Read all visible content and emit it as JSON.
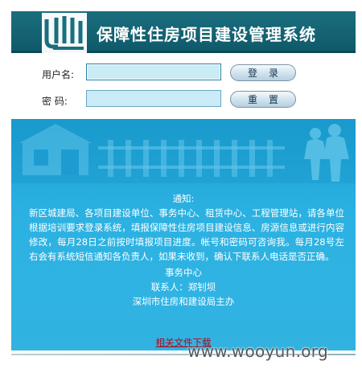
{
  "header": {
    "title": "保障性住房项目建设管理系统",
    "logo": "jh-building-logo"
  },
  "login": {
    "username_label": "用户名:",
    "username_value": "",
    "password_label": "密  码:",
    "password_value": "",
    "login_button": "登录",
    "reset_button": "重置"
  },
  "notice": {
    "title": "通知:",
    "body": "新区城建局、各项目建设单位、事务中心、租赁中心、工程管理站，请各单位根据培训要求登录系统，填报保障性住房项目建设信息、房源信息或进行内容修改，每月28日之前按时填报项目进度。帐号和密码可咨询我。每月28号左右会有系统短信通知各负责人，如果未收到，确认下联系人电话是否正确。",
    "office": "事务中心",
    "contact": "联系人：郑钊坝",
    "sponsor": "深圳市住房和建设局主办",
    "download_link": "相关文件下载"
  },
  "watermark": "www.wooyun.org",
  "colors": {
    "header_bg": "#1a6e7e",
    "notice_bg": "#2bb1e1",
    "input_bg": "#c9ecf6",
    "link": "#b1081a"
  }
}
